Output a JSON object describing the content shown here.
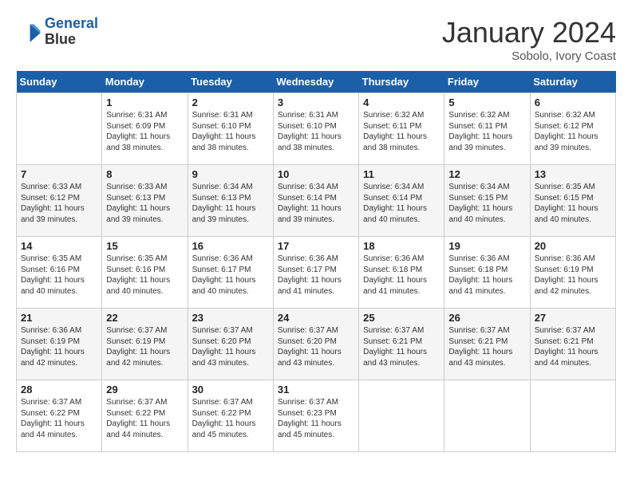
{
  "header": {
    "logo_line1": "General",
    "logo_line2": "Blue",
    "month": "January 2024",
    "location": "Sobolo, Ivory Coast"
  },
  "weekdays": [
    "Sunday",
    "Monday",
    "Tuesday",
    "Wednesday",
    "Thursday",
    "Friday",
    "Saturday"
  ],
  "weeks": [
    [
      {
        "day": "",
        "sunrise": "",
        "sunset": "",
        "daylight": ""
      },
      {
        "day": "1",
        "sunrise": "Sunrise: 6:31 AM",
        "sunset": "Sunset: 6:09 PM",
        "daylight": "Daylight: 11 hours and 38 minutes."
      },
      {
        "day": "2",
        "sunrise": "Sunrise: 6:31 AM",
        "sunset": "Sunset: 6:10 PM",
        "daylight": "Daylight: 11 hours and 38 minutes."
      },
      {
        "day": "3",
        "sunrise": "Sunrise: 6:31 AM",
        "sunset": "Sunset: 6:10 PM",
        "daylight": "Daylight: 11 hours and 38 minutes."
      },
      {
        "day": "4",
        "sunrise": "Sunrise: 6:32 AM",
        "sunset": "Sunset: 6:11 PM",
        "daylight": "Daylight: 11 hours and 38 minutes."
      },
      {
        "day": "5",
        "sunrise": "Sunrise: 6:32 AM",
        "sunset": "Sunset: 6:11 PM",
        "daylight": "Daylight: 11 hours and 39 minutes."
      },
      {
        "day": "6",
        "sunrise": "Sunrise: 6:32 AM",
        "sunset": "Sunset: 6:12 PM",
        "daylight": "Daylight: 11 hours and 39 minutes."
      }
    ],
    [
      {
        "day": "7",
        "sunrise": "Sunrise: 6:33 AM",
        "sunset": "Sunset: 6:12 PM",
        "daylight": "Daylight: 11 hours and 39 minutes."
      },
      {
        "day": "8",
        "sunrise": "Sunrise: 6:33 AM",
        "sunset": "Sunset: 6:13 PM",
        "daylight": "Daylight: 11 hours and 39 minutes."
      },
      {
        "day": "9",
        "sunrise": "Sunrise: 6:34 AM",
        "sunset": "Sunset: 6:13 PM",
        "daylight": "Daylight: 11 hours and 39 minutes."
      },
      {
        "day": "10",
        "sunrise": "Sunrise: 6:34 AM",
        "sunset": "Sunset: 6:14 PM",
        "daylight": "Daylight: 11 hours and 39 minutes."
      },
      {
        "day": "11",
        "sunrise": "Sunrise: 6:34 AM",
        "sunset": "Sunset: 6:14 PM",
        "daylight": "Daylight: 11 hours and 40 minutes."
      },
      {
        "day": "12",
        "sunrise": "Sunrise: 6:34 AM",
        "sunset": "Sunset: 6:15 PM",
        "daylight": "Daylight: 11 hours and 40 minutes."
      },
      {
        "day": "13",
        "sunrise": "Sunrise: 6:35 AM",
        "sunset": "Sunset: 6:15 PM",
        "daylight": "Daylight: 11 hours and 40 minutes."
      }
    ],
    [
      {
        "day": "14",
        "sunrise": "Sunrise: 6:35 AM",
        "sunset": "Sunset: 6:16 PM",
        "daylight": "Daylight: 11 hours and 40 minutes."
      },
      {
        "day": "15",
        "sunrise": "Sunrise: 6:35 AM",
        "sunset": "Sunset: 6:16 PM",
        "daylight": "Daylight: 11 hours and 40 minutes."
      },
      {
        "day": "16",
        "sunrise": "Sunrise: 6:36 AM",
        "sunset": "Sunset: 6:17 PM",
        "daylight": "Daylight: 11 hours and 40 minutes."
      },
      {
        "day": "17",
        "sunrise": "Sunrise: 6:36 AM",
        "sunset": "Sunset: 6:17 PM",
        "daylight": "Daylight: 11 hours and 41 minutes."
      },
      {
        "day": "18",
        "sunrise": "Sunrise: 6:36 AM",
        "sunset": "Sunset: 6:18 PM",
        "daylight": "Daylight: 11 hours and 41 minutes."
      },
      {
        "day": "19",
        "sunrise": "Sunrise: 6:36 AM",
        "sunset": "Sunset: 6:18 PM",
        "daylight": "Daylight: 11 hours and 41 minutes."
      },
      {
        "day": "20",
        "sunrise": "Sunrise: 6:36 AM",
        "sunset": "Sunset: 6:19 PM",
        "daylight": "Daylight: 11 hours and 42 minutes."
      }
    ],
    [
      {
        "day": "21",
        "sunrise": "Sunrise: 6:36 AM",
        "sunset": "Sunset: 6:19 PM",
        "daylight": "Daylight: 11 hours and 42 minutes."
      },
      {
        "day": "22",
        "sunrise": "Sunrise: 6:37 AM",
        "sunset": "Sunset: 6:19 PM",
        "daylight": "Daylight: 11 hours and 42 minutes."
      },
      {
        "day": "23",
        "sunrise": "Sunrise: 6:37 AM",
        "sunset": "Sunset: 6:20 PM",
        "daylight": "Daylight: 11 hours and 43 minutes."
      },
      {
        "day": "24",
        "sunrise": "Sunrise: 6:37 AM",
        "sunset": "Sunset: 6:20 PM",
        "daylight": "Daylight: 11 hours and 43 minutes."
      },
      {
        "day": "25",
        "sunrise": "Sunrise: 6:37 AM",
        "sunset": "Sunset: 6:21 PM",
        "daylight": "Daylight: 11 hours and 43 minutes."
      },
      {
        "day": "26",
        "sunrise": "Sunrise: 6:37 AM",
        "sunset": "Sunset: 6:21 PM",
        "daylight": "Daylight: 11 hours and 43 minutes."
      },
      {
        "day": "27",
        "sunrise": "Sunrise: 6:37 AM",
        "sunset": "Sunset: 6:21 PM",
        "daylight": "Daylight: 11 hours and 44 minutes."
      }
    ],
    [
      {
        "day": "28",
        "sunrise": "Sunrise: 6:37 AM",
        "sunset": "Sunset: 6:22 PM",
        "daylight": "Daylight: 11 hours and 44 minutes."
      },
      {
        "day": "29",
        "sunrise": "Sunrise: 6:37 AM",
        "sunset": "Sunset: 6:22 PM",
        "daylight": "Daylight: 11 hours and 44 minutes."
      },
      {
        "day": "30",
        "sunrise": "Sunrise: 6:37 AM",
        "sunset": "Sunset: 6:22 PM",
        "daylight": "Daylight: 11 hours and 45 minutes."
      },
      {
        "day": "31",
        "sunrise": "Sunrise: 6:37 AM",
        "sunset": "Sunset: 6:23 PM",
        "daylight": "Daylight: 11 hours and 45 minutes."
      },
      {
        "day": "",
        "sunrise": "",
        "sunset": "",
        "daylight": ""
      },
      {
        "day": "",
        "sunrise": "",
        "sunset": "",
        "daylight": ""
      },
      {
        "day": "",
        "sunrise": "",
        "sunset": "",
        "daylight": ""
      }
    ]
  ]
}
